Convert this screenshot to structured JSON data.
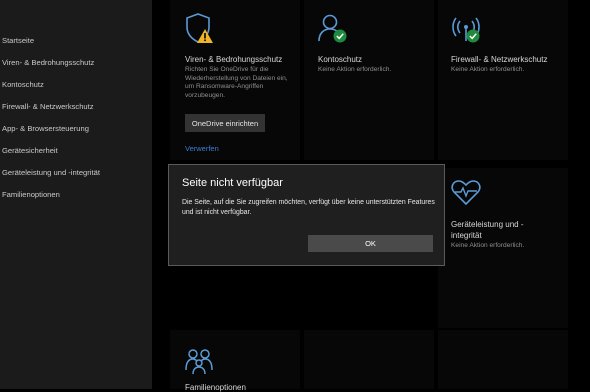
{
  "sidebar": {
    "items": [
      {
        "label": "Startseite"
      },
      {
        "label": "Viren- & Bedrohungsschutz"
      },
      {
        "label": "Kontoschutz"
      },
      {
        "label": "Firewall- & Netzwerkschutz"
      },
      {
        "label": "App- & Browsersteuerung"
      },
      {
        "label": "Gerätesicherheit"
      },
      {
        "label": "Geräteleistung und -integrität"
      },
      {
        "label": "Familienoptionen"
      }
    ]
  },
  "tiles": {
    "virus": {
      "title": "Viren- & Bedrohungsschutz",
      "desc": "Richten Sie OneDrive für die Wiederherstellung von Dateien ein, um Ransomware-Angriffen vorzubeugen.",
      "button": "OneDrive einrichten",
      "link": "Verwerfen",
      "icon": "shield-warning-icon"
    },
    "account": {
      "title": "Kontoschutz",
      "status": "Keine Aktion erforderlich.",
      "icon": "person-check-icon"
    },
    "firewall": {
      "title": "Firewall- & Netzwerkschutz",
      "status": "Keine Aktion erforderlich.",
      "icon": "wifi-check-icon"
    },
    "performance": {
      "title_line1": "Geräteleistung und -",
      "title_line2": "integrität",
      "status": "Keine Aktion erforderlich.",
      "icon": "heart-pulse-icon"
    },
    "family": {
      "title": "Familienoptionen",
      "icon": "family-icon"
    }
  },
  "dialog": {
    "title": "Seite nicht verfügbar",
    "message": "Die Seite, auf die Sie zugreifen möchten, verfügt über keine unterstützten Features und ist nicht verfügbar.",
    "ok": "OK"
  },
  "colors": {
    "accent": "#3a7fd5",
    "icon_blue": "#5b9bd5",
    "check_green": "#1f8a3e",
    "warning": "#f0b429"
  }
}
